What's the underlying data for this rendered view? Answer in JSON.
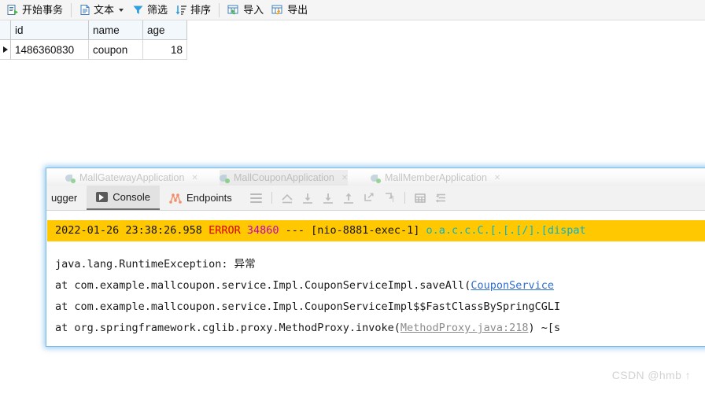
{
  "navicat": {
    "toolbar": {
      "buttons": [
        {
          "label": "开始事务",
          "icon": "begin-transaction-icon",
          "has_caret": false
        },
        {
          "label": "文本",
          "icon": "text-icon",
          "has_caret": true
        },
        {
          "label": "筛选",
          "icon": "filter-icon",
          "has_caret": false
        },
        {
          "label": "排序",
          "icon": "sort-icon",
          "has_caret": false
        },
        {
          "label": "导入",
          "icon": "import-icon",
          "has_caret": false
        },
        {
          "label": "导出",
          "icon": "export-icon",
          "has_caret": false
        }
      ]
    },
    "grid": {
      "columns": [
        "id",
        "name",
        "age"
      ],
      "rows": [
        {
          "id": "1486360830",
          "name": "coupon",
          "age": "18",
          "selected": true
        }
      ]
    }
  },
  "ide": {
    "run_tabs": [
      {
        "label": "MallGatewayApplication",
        "active": false
      },
      {
        "label": "MallCouponApplication",
        "active": true
      },
      {
        "label": "MallMemberApplication",
        "active": false
      }
    ],
    "tabs": [
      {
        "label": "ugger",
        "icon": "debugger-icon",
        "active": false
      },
      {
        "label": "Console",
        "icon": "console-icon",
        "active": true
      },
      {
        "label": "Endpoints",
        "icon": "endpoints-icon",
        "active": false
      }
    ],
    "toolbar_icons": [
      "menu-hamburger-icon",
      "step-out-icon",
      "step-over-icon",
      "step-into-icon",
      "force-step-into-icon",
      "run-to-cursor-icon",
      "evaluate-expression-icon",
      "print-table-icon",
      "soft-wrap-icon"
    ],
    "console": {
      "error_line": {
        "timestamp": "2022-01-26 23:38:26.958",
        "level": "ERROR",
        "pid": "34860",
        "separator": "---",
        "thread": "[nio-8881-exec-1]",
        "logger": "o.a.c.c.C.[.[.[/].[dispat"
      },
      "exception": "java.lang.RuntimeException: 异常",
      "stack": [
        {
          "prefix": "    at com.example.mallcoupon.service.Impl.CouponServiceImpl.saveAll(",
          "link": "CouponService",
          "link_style": "blue",
          "suffix": ""
        },
        {
          "prefix": "    at com.example.mallcoupon.service.Impl.CouponServiceImpl$$FastClassBySpringCGLI",
          "link": "",
          "link_style": "none",
          "suffix": ""
        },
        {
          "prefix": "    at org.springframework.cglib.proxy.MethodProxy.invoke(",
          "link": "MethodProxy.java:218",
          "link_style": "gray",
          "suffix": ") ~[s"
        }
      ]
    }
  },
  "watermark": "CSDN @hmb ↑",
  "colors": {
    "error_highlight": "#ffc800",
    "error_text": "#e00000",
    "pid_text": "#c000c0",
    "logger_text": "#00b4d8",
    "link_blue": "#2f6fd0",
    "link_gray": "#8b8b8b",
    "panel_glow": "#7ab8e8",
    "grid_header": "#f3f8fd"
  }
}
